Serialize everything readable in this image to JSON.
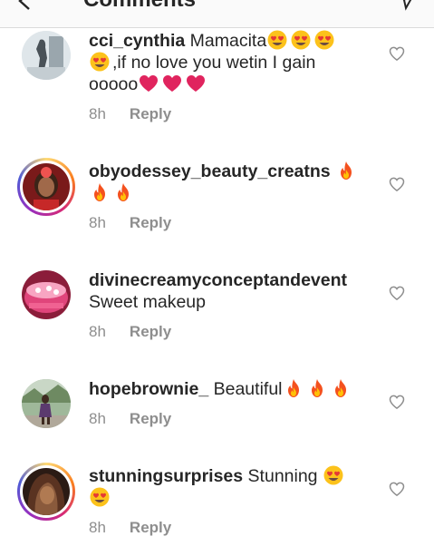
{
  "header": {
    "title": "Comments"
  },
  "comments": [
    {
      "username": "cci_cynthia",
      "text_1": "Mamacita",
      "text_2": ",if no love you wetin I gain",
      "text_3": "ooooo",
      "time": "8h",
      "reply": "Reply",
      "avatar": "avatar-photo-statue",
      "story_ring": false
    },
    {
      "username": "obyodessey_beauty_creatns",
      "time": "8h",
      "reply": "Reply",
      "avatar": "avatar-photo-woman",
      "story_ring": true
    },
    {
      "username": "divinecreamyconceptandevent",
      "text": "Sweet makeup",
      "time": "8h",
      "reply": "Reply",
      "avatar": "avatar-photo-cake",
      "story_ring": false
    },
    {
      "username": "hopebrownie_",
      "text": "Beautiful",
      "time": "8h",
      "reply": "Reply",
      "avatar": "avatar-photo-outdoor",
      "story_ring": false
    },
    {
      "username": "stunningsurprises",
      "text": "Stunning",
      "time": "8h",
      "reply": "Reply",
      "avatar": "avatar-photo-hair",
      "story_ring": true
    }
  ],
  "colors": {
    "text": "#262626",
    "meta": "#8e8e8e",
    "heart_emoji": "#e0245e",
    "fire_emoji": "#f4511e",
    "heart_eyes_face": "#fcc21b"
  },
  "icons": [
    "back-arrow-icon",
    "send-icon",
    "like-heart-icon",
    "heart-eyes-emoji",
    "red-heart-emoji",
    "fire-emoji"
  ]
}
